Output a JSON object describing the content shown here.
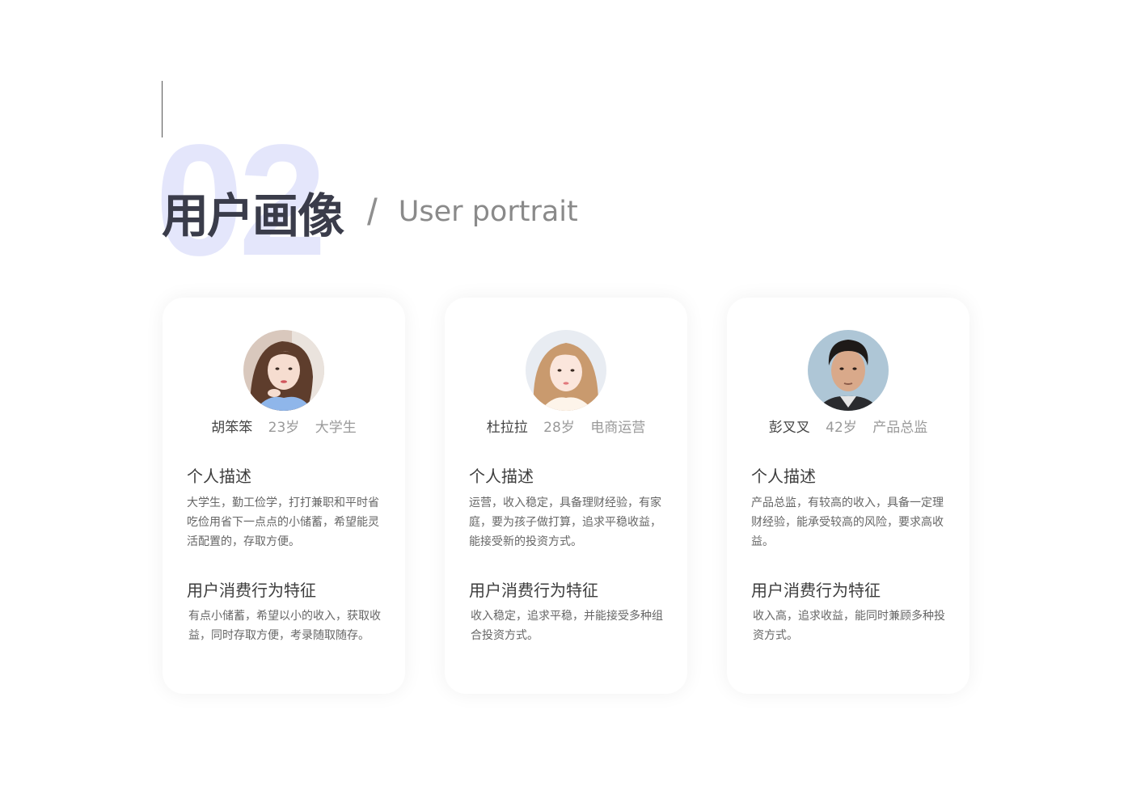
{
  "header": {
    "number": "02",
    "title_cn": "用户画像",
    "slash": "/",
    "title_en": "User portrait"
  },
  "personas": [
    {
      "name": "胡笨笨",
      "age": "23岁",
      "role": "大学生",
      "desc_title": "个人描述",
      "desc": "大学生，勤工俭学，打打兼职和平时省吃俭用省下一点点的小储蓄，希望能灵活配置的，存取方便。",
      "behavior_title": "用户消费行为特征",
      "behavior": "有点小储蓄，希望以小的收入，获取收益，同时存取方便，考录随取随存。"
    },
    {
      "name": "杜拉拉",
      "age": "28岁",
      "role": "电商运营",
      "desc_title": "个人描述",
      "desc": "运营，收入稳定，具备理财经验，有家庭，要为孩子做打算，追求平稳收益，能接受新的投资方式。",
      "behavior_title": "用户消费行为特征",
      "behavior": "收入稳定，追求平稳，并能接受多种组合投资方式。"
    },
    {
      "name": "彭叉叉",
      "age": "42岁",
      "role": "产品总监",
      "desc_title": "个人描述",
      "desc": "产品总监，有较高的收入，具备一定理财经验，能承受较高的风险，要求高收益。",
      "behavior_title": "用户消费行为特征",
      "behavior": "收入高，追求收益，能同时兼顾多种投资方式。"
    }
  ],
  "colors": {
    "number_bg": "#e4e6fb",
    "title": "#3a3c4a",
    "subtitle": "#8a8a8a"
  }
}
